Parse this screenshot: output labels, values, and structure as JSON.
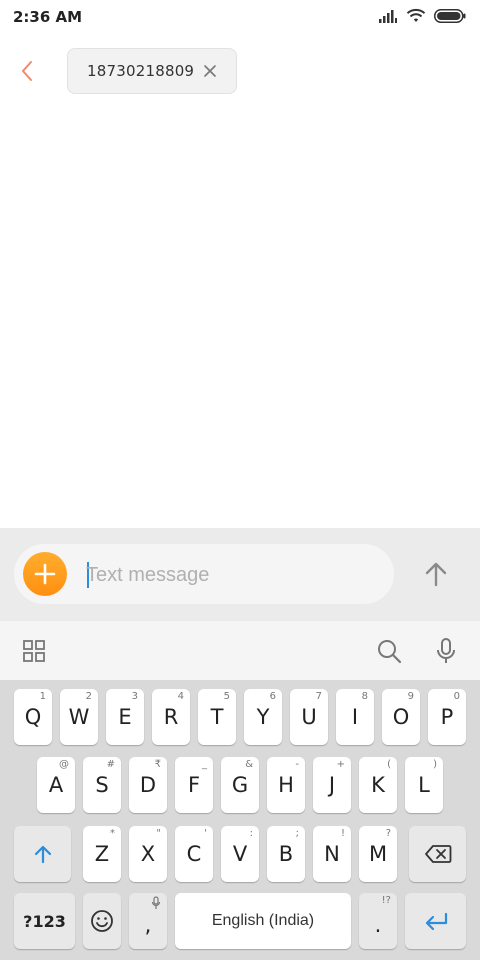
{
  "status_bar": {
    "time": "2:36 AM",
    "icons": [
      "signal-icon",
      "wifi-icon",
      "battery-icon"
    ]
  },
  "header": {
    "back_icon": "chevron-left-icon",
    "recipient": "18730218809",
    "remove_icon": "close-icon"
  },
  "compose": {
    "placeholder": "Text message",
    "value": "",
    "attach_icon": "plus-icon",
    "send_icon": "arrow-up-icon"
  },
  "keyboard_toolbar": {
    "icons": [
      "apps-grid-icon",
      "search-icon",
      "microphone-icon"
    ]
  },
  "keyboard": {
    "row1": [
      {
        "key": "Q",
        "hint": "1"
      },
      {
        "key": "W",
        "hint": "2"
      },
      {
        "key": "E",
        "hint": "3"
      },
      {
        "key": "R",
        "hint": "4"
      },
      {
        "key": "T",
        "hint": "5"
      },
      {
        "key": "Y",
        "hint": "6"
      },
      {
        "key": "U",
        "hint": "7"
      },
      {
        "key": "I",
        "hint": "8"
      },
      {
        "key": "O",
        "hint": "9"
      },
      {
        "key": "P",
        "hint": "0"
      }
    ],
    "row2": [
      {
        "key": "A",
        "hint": "@"
      },
      {
        "key": "S",
        "hint": "#"
      },
      {
        "key": "D",
        "hint": "₹"
      },
      {
        "key": "F",
        "hint": "_"
      },
      {
        "key": "G",
        "hint": "&"
      },
      {
        "key": "H",
        "hint": "-"
      },
      {
        "key": "J",
        "hint": "+"
      },
      {
        "key": "K",
        "hint": "("
      },
      {
        "key": "L",
        "hint": ")"
      }
    ],
    "row3": [
      {
        "key": "Z",
        "hint": "*"
      },
      {
        "key": "X",
        "hint": "\""
      },
      {
        "key": "C",
        "hint": "'"
      },
      {
        "key": "V",
        "hint": ":"
      },
      {
        "key": "B",
        "hint": ";"
      },
      {
        "key": "N",
        "hint": "!"
      },
      {
        "key": "M",
        "hint": "?"
      }
    ],
    "symbols_label": "?123",
    "comma": ",",
    "space_label": "English (India)",
    "period": ".",
    "period_hint": "!?"
  },
  "colors": {
    "accent_orange": "#ff9a1f",
    "back_arrow": "#f08a6c",
    "cursor": "#2b8ddc",
    "enter_key": "#2b8ddc"
  }
}
